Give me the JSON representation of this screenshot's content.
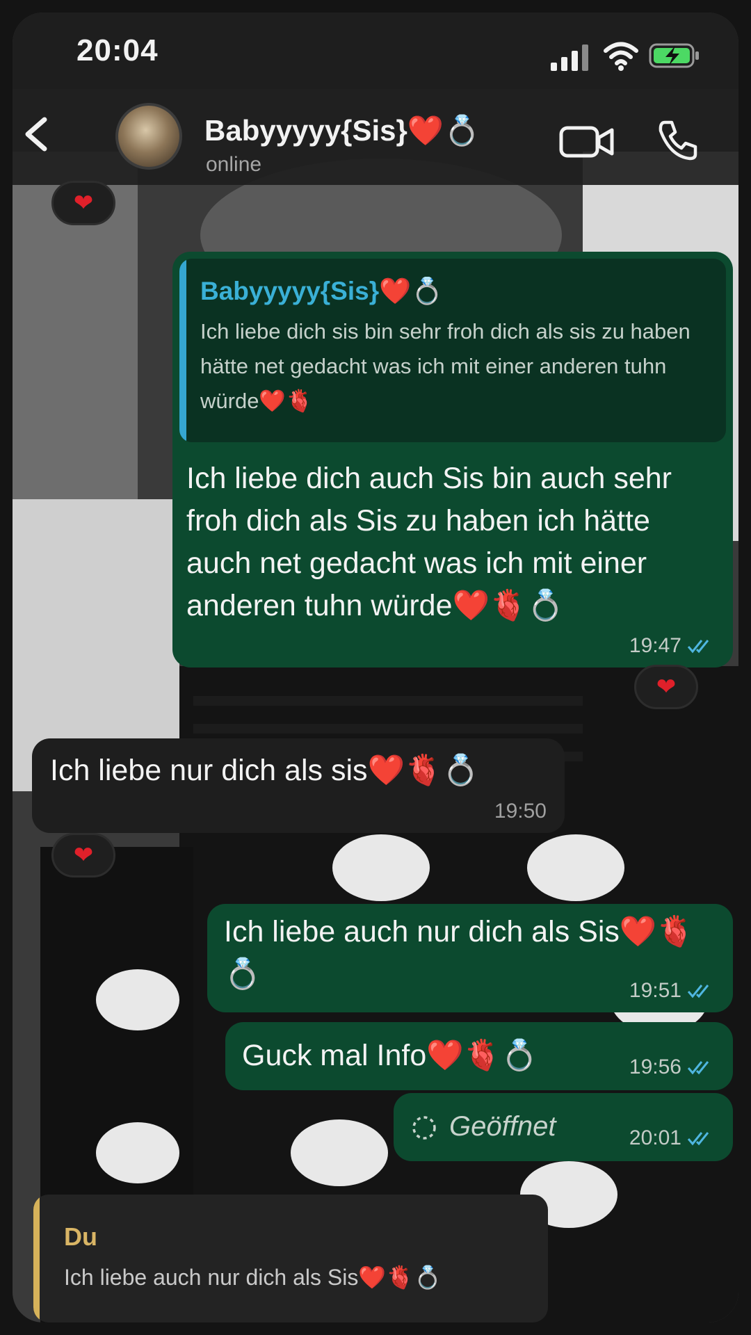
{
  "status_bar": {
    "time": "20:04"
  },
  "header": {
    "contact_name": "Babyyyyy{Sis}❤️💍",
    "contact_status": "online"
  },
  "messages": [
    {
      "type": "outgoing",
      "quote_author": "Babyyyyy{Sis}❤️💍",
      "quote_text": "Ich liebe dich sis bin sehr froh dich als sis zu haben hätte net gedacht was ich mit einer anderen tuhn würde❤️🫀",
      "text": "Ich liebe dich auch Sis bin auch sehr froh dich als Sis zu haben ich hätte auch net gedacht was ich mit einer anderen tuhn würde❤️🫀💍",
      "time": "19:47",
      "reaction": "❤"
    },
    {
      "type": "incoming",
      "text": "Ich liebe nur dich als sis❤️🫀💍",
      "time": "19:50",
      "reaction": "❤"
    },
    {
      "type": "outgoing",
      "text": "Ich liebe auch nur dich als Sis❤️🫀💍",
      "time": "19:51"
    },
    {
      "type": "outgoing",
      "text": "Guck mal Info❤️🫀💍",
      "time": "19:56"
    },
    {
      "type": "outgoing",
      "text": "Geöffnet",
      "time": "20:01"
    }
  ],
  "top_reaction": "❤",
  "reply_preview": {
    "author": "Du",
    "text": "Ich liebe auch nur dich als Sis❤️🫀💍"
  }
}
